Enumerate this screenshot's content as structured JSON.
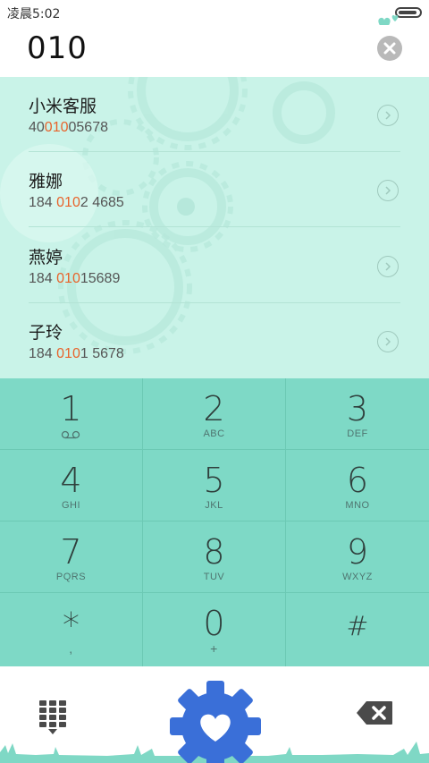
{
  "status_bar": {
    "time": "凌晨5:02",
    "battery_level": 0.9
  },
  "search": {
    "query": "010"
  },
  "results": [
    {
      "name": "小米客服",
      "number_pre": "40",
      "number_match": "010",
      "number_post": "05678"
    },
    {
      "name": "雅娜",
      "number_pre": "184 ",
      "number_match": "010",
      "number_post": "2 4685"
    },
    {
      "name": "燕婷",
      "number_pre": "184 ",
      "number_match": "010",
      "number_post": "15689"
    },
    {
      "name": "子玲",
      "number_pre": "184 ",
      "number_match": "010",
      "number_post": "1 5678"
    }
  ],
  "dialpad": [
    {
      "digit": "1",
      "letters": ""
    },
    {
      "digit": "2",
      "letters": "ABC"
    },
    {
      "digit": "3",
      "letters": "DEF"
    },
    {
      "digit": "4",
      "letters": "GHI"
    },
    {
      "digit": "5",
      "letters": "JKL"
    },
    {
      "digit": "6",
      "letters": "MNO"
    },
    {
      "digit": "7",
      "letters": "PQRS"
    },
    {
      "digit": "8",
      "letters": "TUV"
    },
    {
      "digit": "9",
      "letters": "WXYZ"
    },
    {
      "digit": "*",
      "letters": ","
    },
    {
      "digit": "0",
      "letters": "+"
    },
    {
      "digit": "#",
      "letters": ""
    }
  ],
  "colors": {
    "results_bg": "#c9f3e8",
    "dialpad_bg": "#7ed9c6",
    "highlight": "#e8632b",
    "call_button": "#3a6fd8",
    "grass": "#7fd8c5"
  },
  "icons": {
    "clear": "close-circle-icon",
    "detail": "chevron-right-circle-icon",
    "voicemail": "voicemail-icon",
    "dialpad_toggle": "dialpad-grid-icon",
    "call": "gear-heart-icon",
    "delete": "backspace-icon",
    "decoration": "hearts-icon"
  }
}
